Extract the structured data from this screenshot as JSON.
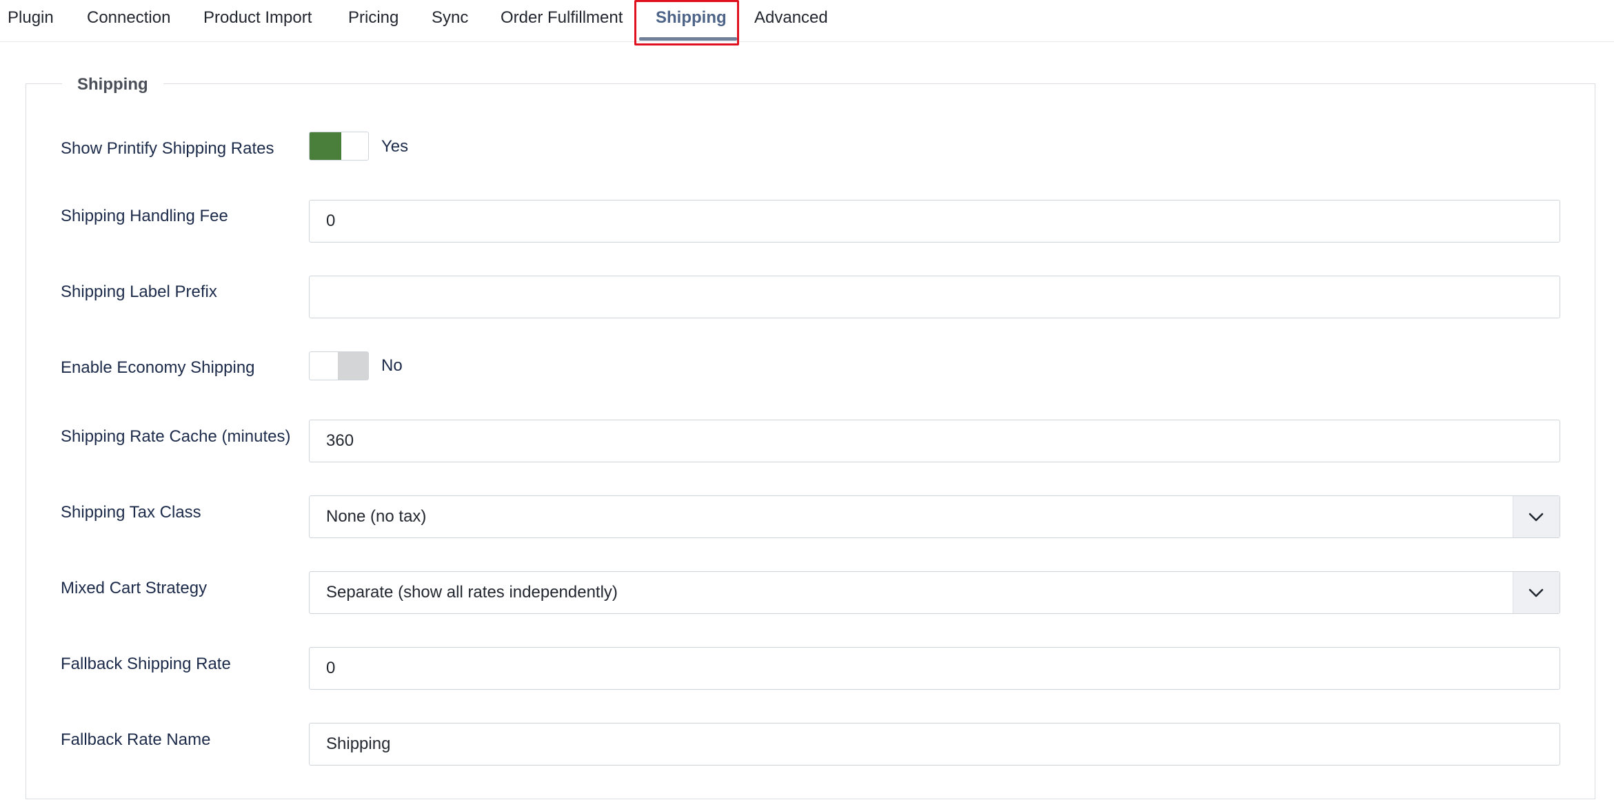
{
  "tabs": [
    {
      "label": "Plugin"
    },
    {
      "label": "Connection"
    },
    {
      "label": "Product Import"
    },
    {
      "label": "Pricing"
    },
    {
      "label": "Sync"
    },
    {
      "label": "Order Fulfillment"
    },
    {
      "label": "Shipping",
      "active": true
    },
    {
      "label": "Advanced"
    }
  ],
  "section": {
    "legend": "Shipping"
  },
  "fields": {
    "show_rates": {
      "label": "Show Printify Shipping Rates",
      "state": "Yes",
      "enabled": true,
      "color_on": "#4a7f3b"
    },
    "handling_fee": {
      "label": "Shipping Handling Fee",
      "value": "0"
    },
    "label_prefix": {
      "label": "Shipping Label Prefix",
      "value": ""
    },
    "economy": {
      "label": "Enable Economy Shipping",
      "state": "No",
      "enabled": false
    },
    "rate_cache": {
      "label": "Shipping Rate Cache (minutes)",
      "value": "360"
    },
    "tax_class": {
      "label": "Shipping Tax Class",
      "value": "None (no tax)"
    },
    "mixed_cart": {
      "label": "Mixed Cart Strategy",
      "value": "Separate (show all rates independently)"
    },
    "fallback_rate": {
      "label": "Fallback Shipping Rate",
      "value": "0"
    },
    "fallback_name": {
      "label": "Fallback Rate Name",
      "value": "Shipping"
    }
  },
  "colors": {
    "accent": "#4d6387",
    "highlight": "#e0101e",
    "label": "#1c2a4a"
  }
}
